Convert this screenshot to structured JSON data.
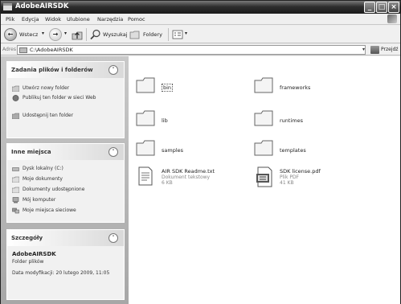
{
  "window": {
    "title": "AdobeAIRSDK"
  },
  "menu": [
    "Plik",
    "Edycja",
    "Widok",
    "Ulubione",
    "Narzędzia",
    "Pomoc"
  ],
  "toolbar": {
    "back_label": "Wstecz",
    "search_label": "Wyszukaj",
    "folders_label": "Foldery"
  },
  "address": {
    "label": "Adres",
    "value": "C:\\AdobeAIRSDK",
    "go_label": "Przejdź"
  },
  "tasks_panel": {
    "title": "Zadania plików i folderów",
    "items": [
      "Utwórz nowy folder",
      "Publikuj ten folder w sieci Web",
      "Udostępnij ten folder"
    ]
  },
  "places_panel": {
    "title": "Inne miejsca",
    "items": [
      "Dysk lokalny (C:)",
      "Moje dokumenty",
      "Dokumenty udostępnione",
      "Mój komputer",
      "Moje miejsca sieciowe"
    ]
  },
  "details_panel": {
    "title": "Szczegóły",
    "name": "AdobeAIRSDK",
    "type": "Folder plików",
    "modified": "Data modyfikacji: 20 lutego 2009, 11:05"
  },
  "folders": [
    "bin",
    "frameworks",
    "lib",
    "runtimes",
    "samples",
    "templates"
  ],
  "files": [
    {
      "name": "AIR SDK Readme.txt",
      "type": "Dokument tekstowy",
      "size": "6 KB"
    },
    {
      "name": "SDK license.pdf",
      "type": "Plik PDF",
      "size": "41 KB"
    }
  ]
}
